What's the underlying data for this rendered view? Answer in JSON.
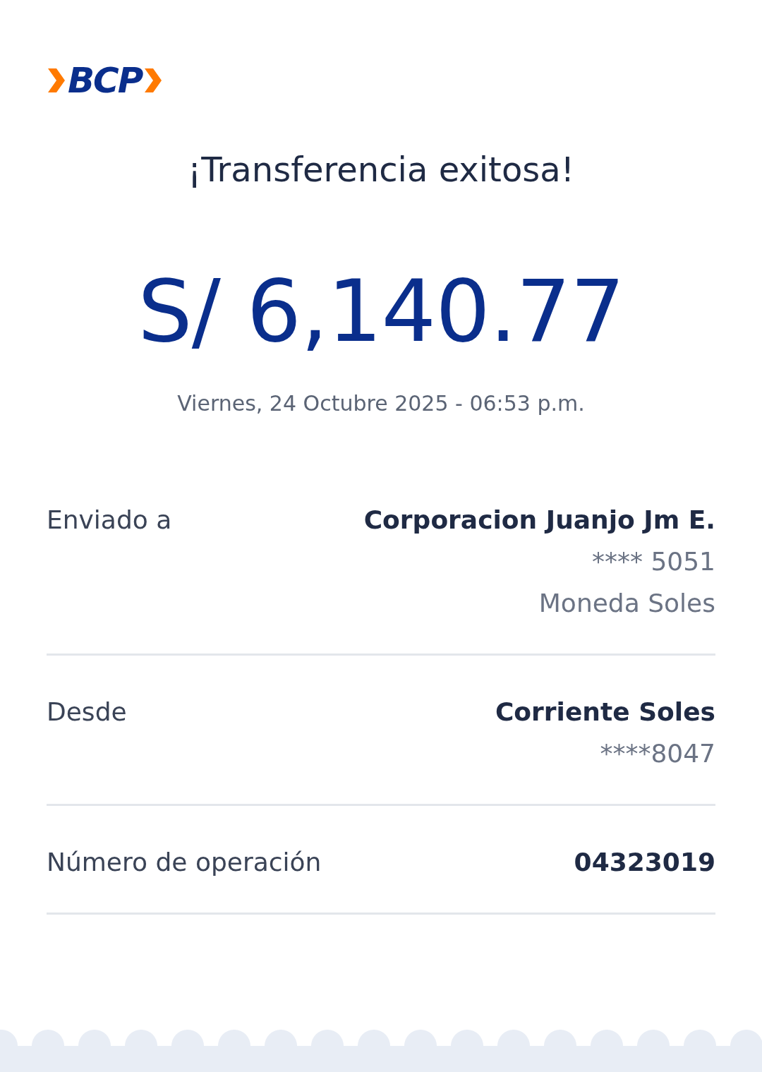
{
  "logo": {
    "text": "BCP"
  },
  "title": "¡Transferencia exitosa!",
  "amount": "S/ 6,140.77",
  "datetime": "Viernes, 24 Octubre 2025 - 06:53 p.m.",
  "details": [
    {
      "label": "Enviado a",
      "lines": [
        {
          "text": "Corporacion Juanjo Jm E.",
          "kind": "strong"
        },
        {
          "text": "**** 5051",
          "kind": "muted"
        },
        {
          "text": "Moneda Soles",
          "kind": "muted"
        }
      ]
    },
    {
      "label": "Desde",
      "lines": [
        {
          "text": "Corriente Soles",
          "kind": "strong"
        },
        {
          "text": "****8047",
          "kind": "muted"
        }
      ]
    },
    {
      "label": "Número de operación",
      "lines": [
        {
          "text": "04323019",
          "kind": "strong"
        }
      ]
    }
  ]
}
